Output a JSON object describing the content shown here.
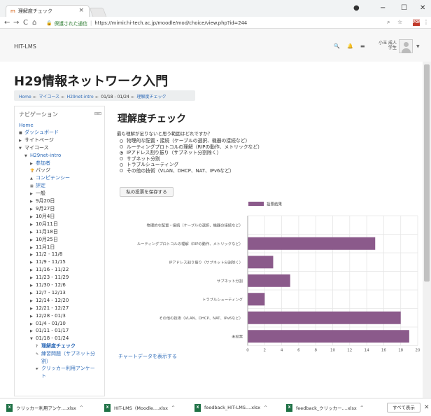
{
  "browser": {
    "tab_title": "理解度チェック",
    "tab_close": "×",
    "window_controls": {
      "user": "●",
      "minimize": "−",
      "maximize": "☐",
      "close": "✕"
    },
    "nav": {
      "back": "←",
      "forward": "→",
      "reload": "C",
      "home": "⌂"
    },
    "secure_label": "保護された通信",
    "url": "https://mimir.hi-tech.ac.jp/moodle/mod/choice/view.php?id=244",
    "pdf_label": "PDF"
  },
  "site": {
    "name": "HIT-LMS",
    "user_name": "小玉 成人",
    "user_role": "学生"
  },
  "course_title": "H29情報ネットワーク入門",
  "breadcrumb": [
    {
      "label": "Home",
      "link": true
    },
    {
      "label": "マイコース",
      "link": true
    },
    {
      "label": "H29net-intro",
      "link": true
    },
    {
      "label": "01/18 - 01/24",
      "link": false
    },
    {
      "label": "理解度チェック",
      "link": true
    }
  ],
  "breadcrumb_sep": "►",
  "navigation": {
    "title": "ナビゲーション",
    "items": [
      {
        "label": "Home",
        "indent": 0,
        "arrow": "",
        "style": "link"
      },
      {
        "label": "ダッシュボード",
        "indent": 0,
        "arrow": "■",
        "style": "link"
      },
      {
        "label": "サイトページ",
        "indent": 0,
        "arrow": "▶",
        "style": "text"
      },
      {
        "label": "マイコース",
        "indent": 0,
        "arrow": "▼",
        "style": "text"
      },
      {
        "label": "H29net-intro",
        "indent": 1,
        "arrow": "▼",
        "style": "link"
      },
      {
        "label": "参加者",
        "indent": 2,
        "arrow": "▶",
        "style": "link"
      },
      {
        "label": "バッジ",
        "indent": 2,
        "arrow": "🏆",
        "style": "text"
      },
      {
        "label": "コンピテンシー",
        "indent": 2,
        "arrow": "▲",
        "style": "link"
      },
      {
        "label": "評定",
        "indent": 2,
        "arrow": "▦",
        "style": "link"
      },
      {
        "label": "一般",
        "indent": 2,
        "arrow": "▶",
        "style": "text"
      },
      {
        "label": "9月20日",
        "indent": 2,
        "arrow": "▶",
        "style": "text"
      },
      {
        "label": "9月27日",
        "indent": 2,
        "arrow": "▶",
        "style": "text"
      },
      {
        "label": "10月4日",
        "indent": 2,
        "arrow": "▶",
        "style": "text"
      },
      {
        "label": "10月11日",
        "indent": 2,
        "arrow": "▶",
        "style": "text"
      },
      {
        "label": "11月18日",
        "indent": 2,
        "arrow": "▶",
        "style": "text"
      },
      {
        "label": "10月25日",
        "indent": 2,
        "arrow": "▶",
        "style": "text"
      },
      {
        "label": "11月1日",
        "indent": 2,
        "arrow": "▶",
        "style": "text"
      },
      {
        "label": "11/2 - 11/8",
        "indent": 2,
        "arrow": "▶",
        "style": "text"
      },
      {
        "label": "11/9 - 11/15",
        "indent": 2,
        "arrow": "▶",
        "style": "text"
      },
      {
        "label": "11/16 - 11/22",
        "indent": 2,
        "arrow": "▶",
        "style": "text"
      },
      {
        "label": "11/23 - 11/29",
        "indent": 2,
        "arrow": "▶",
        "style": "text"
      },
      {
        "label": "11/30 - 12/6",
        "indent": 2,
        "arrow": "▶",
        "style": "text"
      },
      {
        "label": "12/7 - 12/13",
        "indent": 2,
        "arrow": "▶",
        "style": "text"
      },
      {
        "label": "12/14 - 12/20",
        "indent": 2,
        "arrow": "▶",
        "style": "text"
      },
      {
        "label": "12/21 - 12/27",
        "indent": 2,
        "arrow": "▶",
        "style": "text"
      },
      {
        "label": "12/28 - 01/3",
        "indent": 2,
        "arrow": "▶",
        "style": "text"
      },
      {
        "label": "01/4 - 01/10",
        "indent": 2,
        "arrow": "▶",
        "style": "text"
      },
      {
        "label": "01/11 - 01/17",
        "indent": 2,
        "arrow": "▶",
        "style": "text"
      },
      {
        "label": "01/18 - 01/24",
        "indent": 2,
        "arrow": "▼",
        "style": "text"
      },
      {
        "label": "理解度チェック",
        "indent": 3,
        "arrow": "?",
        "style": "current"
      },
      {
        "label": "練習問題（サブネット分",
        "indent": 3,
        "arrow": "✎",
        "style": "link"
      },
      {
        "label": "割）",
        "indent": 4,
        "arrow": "",
        "style": "link"
      },
      {
        "label": "クリッカー利用アンケー",
        "indent": 3,
        "arrow": "☛",
        "style": "link"
      },
      {
        "label": "ト",
        "indent": 4,
        "arrow": "",
        "style": "link"
      }
    ]
  },
  "choice": {
    "title": "理解度チェック",
    "question": "最も理解が足りないと思う範囲はどれですか？",
    "options": [
      {
        "label": "物理的な配置・接続（ケーブルの選択、機器の接続など）",
        "selected": false
      },
      {
        "label": "ルーティングプロトコルの理解（RIPの動作、メトリックなど）",
        "selected": false
      },
      {
        "label": "IPアドレス割り振り（サブネット分割除く）",
        "selected": true
      },
      {
        "label": "サブネット分割",
        "selected": false
      },
      {
        "label": "トラブルシューティング",
        "selected": false
      },
      {
        "label": "その他の技術（VLAN、DHCP、NAT、IPv6など）",
        "selected": false
      }
    ],
    "save_button": "私の投票を保存する",
    "chart_link": "チャートデータを表示する"
  },
  "chart_data": {
    "type": "bar",
    "orientation": "horizontal",
    "categories": [
      "物理的な配置・接続（ケーブルの選択、機器の接続など）",
      "ルーティングプロトコルの理解（RIPの動作、メトリックなど）",
      "IPアドレス割り振り（サブネット分割除く）",
      "サブネット分割",
      "トラブルシューティング",
      "その他の技術（VLAN、DHCP、NAT、IPv6など）",
      "未投票"
    ],
    "series": [
      {
        "name": "投票結果",
        "values": [
          0,
          15,
          3,
          5,
          2,
          18,
          19
        ],
        "color": "#8b5a8b"
      }
    ],
    "xlim": [
      0,
      20
    ],
    "xticks": [
      0,
      2,
      4,
      6,
      8,
      10,
      12,
      14,
      16,
      18,
      20
    ],
    "legend_position": "top",
    "grid": true
  },
  "downloads": {
    "items": [
      {
        "label": "クリッカー利用アンケ....xlsx"
      },
      {
        "label": "HIT-LMS（Moodle....xlsx"
      },
      {
        "label": "feedback_HIT-LMS....xlsx"
      },
      {
        "label": "feedback_クリッカー....xlsx"
      }
    ],
    "caret": "^",
    "file_icon": "X",
    "show_all": "すべて表示",
    "close": "✕"
  }
}
